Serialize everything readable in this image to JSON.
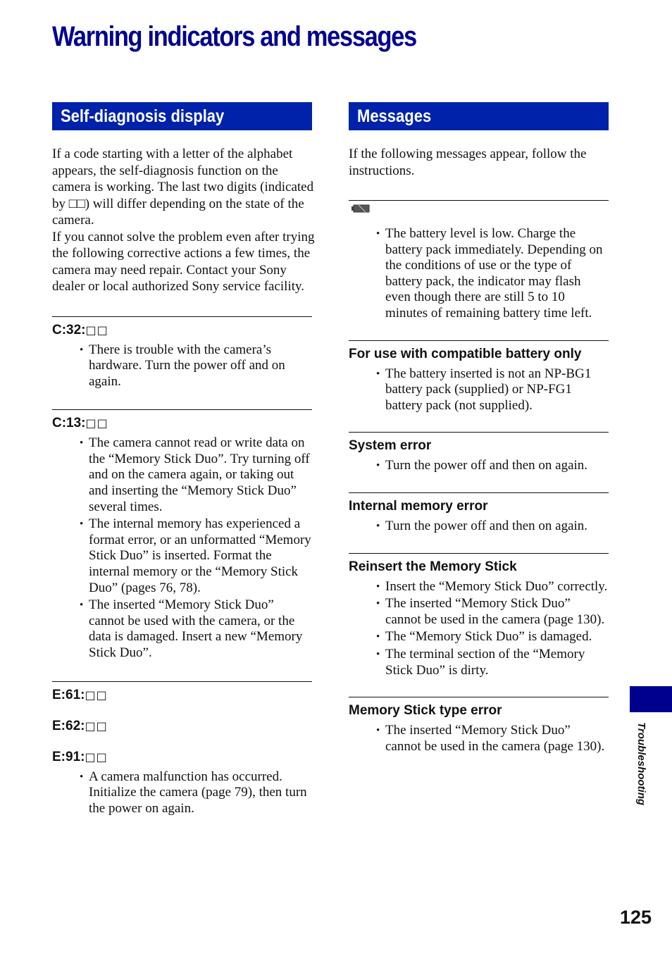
{
  "page": {
    "title": "Warning indicators and messages",
    "side_tab_label": "Troubleshooting",
    "page_number": "125",
    "accent_color": "#0022aa",
    "title_color": "#00008f"
  },
  "left": {
    "banner": "Self-diagnosis display",
    "intro": "If a code starting with a letter of the alphabet appears, the self-diagnosis function on the camera is working. The last two digits (indicated by □□) will differ depending on the state of the camera.\nIf you cannot solve the problem even after trying the following corrective actions a few times, the camera may need repair. Contact your Sony dealer or local authorized Sony service facility.",
    "sections": [
      {
        "codes": [
          "C:32:"
        ],
        "bullets": [
          "There is trouble with the camera’s hardware. Turn the power off and on again."
        ]
      },
      {
        "codes": [
          "C:13:"
        ],
        "bullets": [
          "The camera cannot read or write data on the “Memory Stick Duo”. Try turning off and on the camera again, or taking out and inserting the “Memory Stick Duo” several times.",
          "The internal memory has experienced a format error, or an unformatted “Memory Stick Duo” is inserted. Format the internal memory or the “Memory Stick Duo” (pages 76, 78).",
          "The inserted “Memory Stick Duo” cannot be used with the camera, or the data is damaged. Insert a new “Memory Stick Duo”."
        ]
      },
      {
        "codes": [
          "E:61:",
          "E:62:",
          "E:91:"
        ],
        "bullets": [
          "A camera malfunction has occurred. Initialize the camera (page 79), then turn the power on again."
        ]
      }
    ],
    "code_placeholder": "□□"
  },
  "right": {
    "banner": "Messages",
    "intro": "If the following messages appear, follow the instructions.",
    "battery": {
      "icon": "low-battery-icon",
      "bullets": [
        "The battery level is low. Charge the battery pack immediately. Depending on the conditions of use or the type of battery pack, the indicator may flash even though there are still 5 to 10 minutes of remaining battery time left."
      ]
    },
    "sections": [
      {
        "heading": "For use with compatible battery only",
        "bullets": [
          "The battery inserted is not an NP-BG1 battery pack (supplied) or NP-FG1 battery pack (not supplied)."
        ]
      },
      {
        "heading": "System error",
        "bullets": [
          "Turn the power off and then on again."
        ]
      },
      {
        "heading": "Internal memory error",
        "bullets": [
          "Turn the power off and then on again."
        ]
      },
      {
        "heading": "Reinsert the Memory Stick",
        "bullets": [
          "Insert the “Memory Stick Duo” correctly.",
          "The inserted “Memory Stick Duo” cannot be used in the camera (page 130).",
          "The “Memory Stick Duo” is damaged.",
          "The terminal section of the “Memory Stick Duo” is dirty."
        ]
      },
      {
        "heading": "Memory Stick type error",
        "bullets": [
          "The inserted “Memory Stick Duo” cannot be used in the camera (page 130)."
        ]
      }
    ]
  }
}
